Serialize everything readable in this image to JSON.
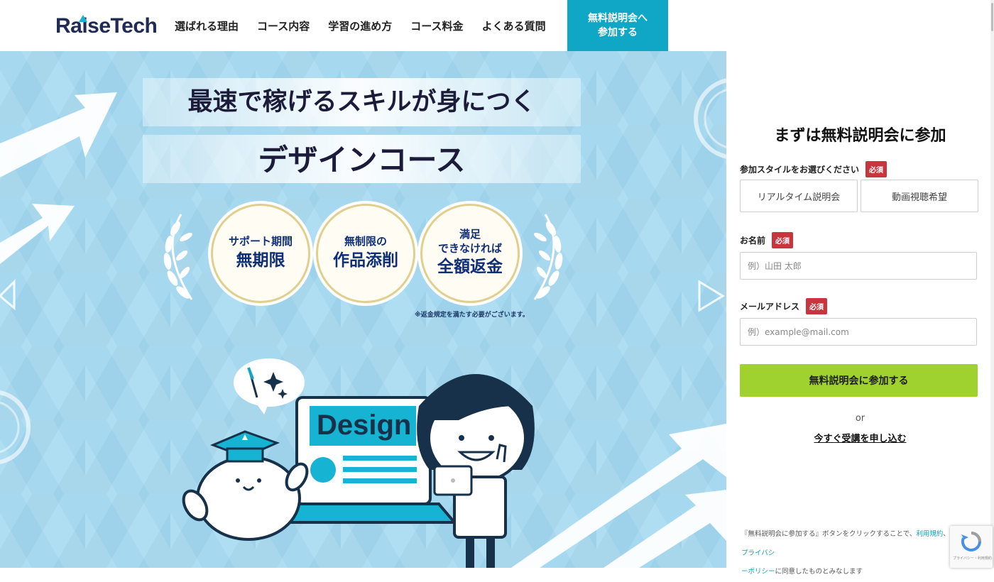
{
  "header": {
    "logo": "RaiseTech",
    "nav": [
      "選ばれる理由",
      "コース内容",
      "学習の進め方",
      "コース料金",
      "よくある質問"
    ],
    "cta_line1": "無料説明会へ",
    "cta_line2": "参加する"
  },
  "hero": {
    "headline": "最速で稼げるスキルが身につく",
    "course": "デザインコース",
    "badges": [
      {
        "small": "サポート期間",
        "big": "無期限"
      },
      {
        "small": "無制限の",
        "big": "作品添削"
      },
      {
        "small": "満足\nできなければ",
        "big": "全額返金"
      }
    ],
    "note": "※返金規定を満たす必要がございます。",
    "screen_label": "Design"
  },
  "form": {
    "title": "まずは無料説明会に参加",
    "style_label": "参加スタイルをお選びください",
    "required": "必須",
    "style_options": [
      "リアルタイム説明会",
      "動画視聴希望"
    ],
    "name_label": "お名前",
    "name_placeholder": "例）山田 太郎",
    "email_label": "メールアドレス",
    "email_placeholder": "例）example@mail.com",
    "submit": "無料説明会に参加する",
    "or": "or",
    "apply_now": "今すぐ受講を申し込む",
    "consent_1": "『無料説明会に参加する』ボタンをクリックすることで、",
    "consent_link1": "利用規約",
    "consent_2": "、",
    "consent_link2a": "プライバシ",
    "consent_link2b": "ーポリシー",
    "consent_3": "に同意したものとみなします",
    "recaptcha_text": "プライバシー・利用規約"
  },
  "colors": {
    "accent": "#10a6c6",
    "submit": "#9fd22e",
    "required": "#c9353d",
    "hero_bg": "#a6d9ef",
    "badge_text": "#0e2f78"
  }
}
